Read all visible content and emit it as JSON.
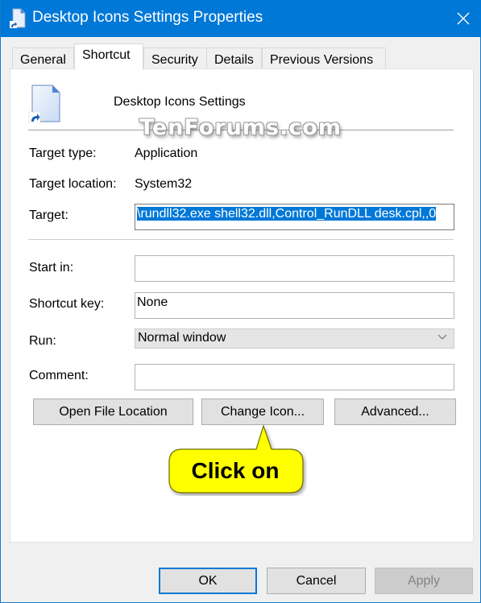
{
  "window": {
    "title": "Desktop Icons Settings Properties",
    "accent_color": "#0078d7"
  },
  "tabs": [
    {
      "label": "General",
      "active": false
    },
    {
      "label": "Shortcut",
      "active": true
    },
    {
      "label": "Security",
      "active": false
    },
    {
      "label": "Details",
      "active": false
    },
    {
      "label": "Previous Versions",
      "active": false
    }
  ],
  "shortcut": {
    "name": "Desktop Icons Settings",
    "target_type_label": "Target type:",
    "target_type": "Application",
    "target_location_label": "Target location:",
    "target_location": "System32",
    "target_label": "Target:",
    "target_value": "\\rundll32.exe shell32.dll,Control_RunDLL desk.cpl,,0",
    "start_in_label": "Start in:",
    "start_in_value": "",
    "shortcut_key_label": "Shortcut key:",
    "shortcut_key_value": "None",
    "run_label": "Run:",
    "run_value": "Normal window",
    "comment_label": "Comment:",
    "comment_value": ""
  },
  "actions": {
    "open_file_location": "Open File Location",
    "change_icon": "Change Icon...",
    "advanced": "Advanced..."
  },
  "footer": {
    "ok": "OK",
    "cancel": "Cancel",
    "apply": "Apply"
  },
  "annotations": {
    "watermark": "TenForums.com",
    "callout": "Click on",
    "callout_color": "#ffff00"
  }
}
